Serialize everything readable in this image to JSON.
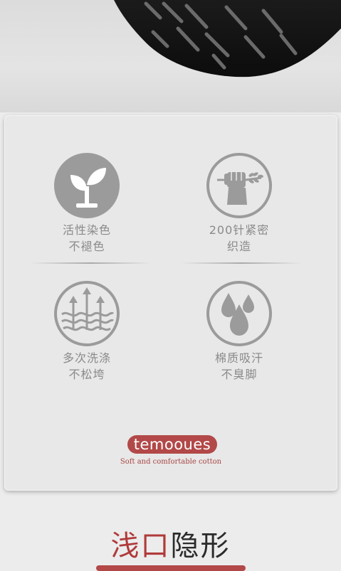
{
  "features": [
    {
      "id": "dye",
      "line1": "活性染色",
      "line2": "不褪色",
      "icon": "sprout-icon"
    },
    {
      "id": "knit",
      "line1": "200针紧密",
      "line2": "织造",
      "icon": "fist-wheat-icon"
    },
    {
      "id": "wash",
      "line1": "多次洗涤",
      "line2": "不松垮",
      "icon": "wave-arrows-icon"
    },
    {
      "id": "absorb",
      "line1": "棉质吸汗",
      "line2": "不臭脚",
      "icon": "water-drops-icon"
    }
  ],
  "brand": {
    "name": "temooues",
    "tagline": "Soft and comfortable cotton",
    "color": "#b24848"
  },
  "section": {
    "title_red": "浅口",
    "title_dark": "隐形"
  },
  "colors": {
    "icon_gray": "#9a9a9a",
    "label_gray": "#8a8a8a",
    "accent_red": "#b03a3a"
  }
}
